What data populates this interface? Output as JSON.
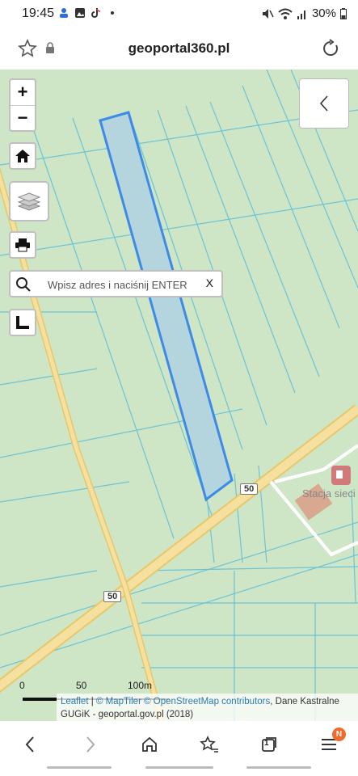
{
  "status_bar": {
    "time": "19:45",
    "battery": "30%"
  },
  "browser": {
    "url": "geoportal360.pl"
  },
  "map": {
    "zoom_in_label": "+",
    "zoom_out_label": "−",
    "search": {
      "placeholder": "Wpisz adres i naciśnij ENTER",
      "clear_label": "X"
    },
    "road_labels": [
      "50",
      "50"
    ],
    "place_label": "Stacja sieci",
    "scale": {
      "label_0": "0",
      "label_50": "50",
      "label_100": "100m"
    },
    "attribution": {
      "leaflet": "Leaflet",
      "sep1": " | ",
      "maptiler": "© MapTiler",
      "space": " ",
      "osm": "© OpenStreetMap contributors",
      "rest": ", Dane Kastralne GUGiK - geoportal.gov.pl (2018)"
    }
  },
  "bottom_nav": {
    "tabs_count": "1",
    "badge": "N"
  },
  "colors": {
    "map_bg": "#cfe6c6",
    "parcel_line": "#6cc3d6",
    "road": "#f2d98a",
    "selection": "#3d8ae8"
  }
}
